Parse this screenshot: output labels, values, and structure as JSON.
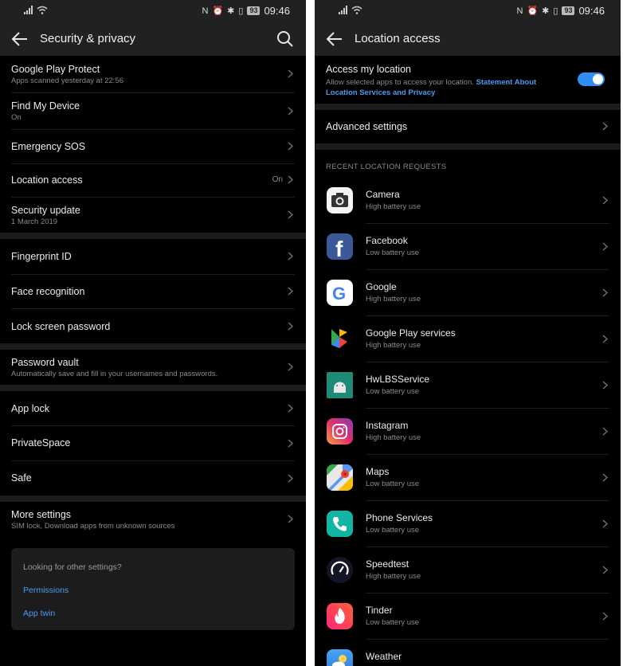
{
  "status_bar": {
    "time": "09:46",
    "battery": "93"
  },
  "left": {
    "title": "Security & privacy",
    "items": [
      {
        "title": "Google Play Protect",
        "subtitle": "Apps scanned yesterday at 22:56"
      },
      {
        "title": "Find My Device",
        "subtitle": "On"
      },
      {
        "title": "Emergency SOS"
      },
      {
        "title": "Location access",
        "value": "On"
      },
      {
        "title": "Security update",
        "subtitle": "1 March 2019"
      },
      {
        "title": "Fingerprint ID"
      },
      {
        "title": "Face recognition"
      },
      {
        "title": "Lock screen password"
      },
      {
        "title": "Password vault",
        "subtitle": "Automatically save and fill in your usernames and passwords."
      },
      {
        "title": "App lock"
      },
      {
        "title": "PrivateSpace"
      },
      {
        "title": "Safe"
      },
      {
        "title": "More settings",
        "subtitle": "SIM lock, Download apps from unknown sources"
      }
    ],
    "card": {
      "question": "Looking for other settings?",
      "link1": "Permissions",
      "link2": "App twin"
    }
  },
  "right": {
    "title": "Location access",
    "access": {
      "title": "Access my location",
      "desc": "Allow selected apps to access your location.",
      "link": "Statement About Location Services and Privacy",
      "enabled": true
    },
    "advanced": "Advanced settings",
    "section_header": "RECENT LOCATION REQUESTS",
    "apps": [
      {
        "name": "Camera",
        "usage": "High battery use",
        "icon": "camera-icon"
      },
      {
        "name": "Facebook",
        "usage": "Low battery use",
        "icon": "facebook-icon"
      },
      {
        "name": "Google",
        "usage": "High battery use",
        "icon": "google-icon"
      },
      {
        "name": "Google Play services",
        "usage": "High battery use",
        "icon": "play-services-icon"
      },
      {
        "name": "HwLBSService",
        "usage": "Low battery use",
        "icon": "android-icon"
      },
      {
        "name": "Instagram",
        "usage": "High battery use",
        "icon": "instagram-icon"
      },
      {
        "name": "Maps",
        "usage": "Low battery use",
        "icon": "maps-icon"
      },
      {
        "name": "Phone Services",
        "usage": "Low battery use",
        "icon": "phone-icon"
      },
      {
        "name": "Speedtest",
        "usage": "High battery use",
        "icon": "speedtest-icon"
      },
      {
        "name": "Tinder",
        "usage": "Low battery use",
        "icon": "tinder-icon"
      },
      {
        "name": "Weather",
        "usage": "",
        "icon": "weather-icon"
      }
    ]
  }
}
